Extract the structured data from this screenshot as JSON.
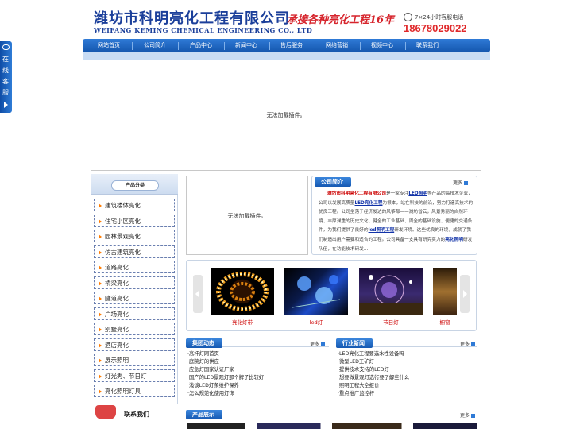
{
  "header": {
    "company_cn": "潍坊市科明亮化工程有限公司",
    "company_en": "WEIFANG KEMING CHEMICAL ENGINEERING CO., LTD",
    "slogan": "承接各种亮化工程16年",
    "service_label": "7×24小时客服电话",
    "phone": "18678029022",
    "phone_icon": "phone-icon"
  },
  "nav": {
    "items": [
      "网站首页",
      "公司简介",
      "产品中心",
      "新闻中心",
      "售后服务",
      "网络营销",
      "视频中心",
      "联系我们"
    ]
  },
  "side_tab": {
    "label": "在线客服",
    "chars": [
      "在",
      "线",
      "客",
      "服"
    ],
    "icon": "chat-icon"
  },
  "banner": {
    "plugin_text": "无法加载插件。"
  },
  "categories": {
    "header": "产品分类",
    "items": [
      "建筑楼体亮化",
      "住宅小区亮化",
      "园林景观亮化",
      "仿古建筑亮化",
      "道路亮化",
      "桥梁亮化",
      "隧道亮化",
      "广场亮化",
      "别墅亮化",
      "酒店亮化",
      "展示照明",
      "灯光秀、节日灯",
      "亮化照明灯具"
    ]
  },
  "contact": {
    "label": "联系我们",
    "icon": "telephone-icon"
  },
  "mid_plugin": {
    "plugin_text": "无法加载插件。"
  },
  "intro": {
    "tab": "公司简介",
    "more": "更多",
    "company": "潍坊市科明亮化工程有限公司",
    "t1": "是一家专注",
    "k1": "LED照明",
    "t2": "等产品的高技术企业，公司以发展高质量",
    "k2": "LED亮化工程",
    "t3": "为根本，站在科技的前沿，努力打造高技术的优良工程。公司坐落于经济发达的风筝都——潍坊省云，风景秀丽的自然环境、丰厚渊重的历史文化、健全的工业基础、周全的基础设施、便捷的交通条件，为我们提供了良好的",
    "k3": "led照明工程",
    "t4": "研发环境。这些优良的环境，成就了我们制造出用户需要和适合的工程。公司具备一支具有研究实力的",
    "k4": "亮化照明",
    "t5": "研发队伍，在功能技术研发..."
  },
  "gallery": {
    "items": [
      {
        "caption": "亮化灯带"
      },
      {
        "caption": "led灯"
      },
      {
        "caption": "节日灯"
      },
      {
        "caption": "橱窗"
      }
    ],
    "left_icon": "arrow-left-icon",
    "right_icon": "arrow-right-icon"
  },
  "news_group": {
    "tab": "集团动态",
    "more": "更多",
    "items": [
      "·高杆灯网首页",
      "·庭院灯的供应",
      "·应急灯国家认证厂家",
      "·国产的LED景观灯那个牌子比较好",
      "·浅谈LED灯条维护保养",
      "·怎么规范化使用灯饰"
    ]
  },
  "news_industry": {
    "tab": "行业新闻",
    "more": "更多",
    "items": [
      "·LED亮化工程要选水性设备吗",
      "·微型LED工矿灯",
      "·提供技术支持的LED灯",
      "·想要做景观灯选行要了解些什么",
      "·照明工程大全报价",
      "·重点推广监控杆"
    ]
  },
  "products": {
    "tab": "产品展示",
    "more": "更多"
  }
}
